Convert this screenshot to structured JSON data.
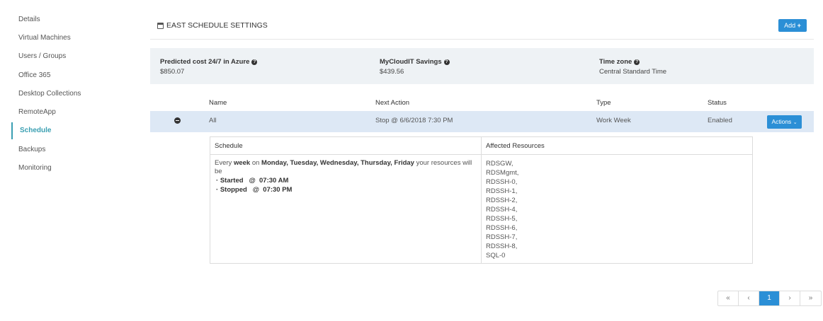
{
  "sidebar": {
    "items": [
      {
        "label": "Details"
      },
      {
        "label": "Virtual Machines"
      },
      {
        "label": "Users / Groups"
      },
      {
        "label": "Office 365"
      },
      {
        "label": "Desktop Collections"
      },
      {
        "label": "RemoteApp"
      },
      {
        "label": "Schedule"
      },
      {
        "label": "Backups"
      },
      {
        "label": "Monitoring"
      }
    ],
    "active": "Schedule"
  },
  "header": {
    "title": "EAST SCHEDULE SETTINGS",
    "add_label": "Add",
    "add_icon": "plus-icon"
  },
  "summary": {
    "predicted": {
      "label": "Predicted cost 24/7 in Azure",
      "value": "$850.07"
    },
    "savings": {
      "label": "MyCloudIT Savings",
      "value": "$439.56"
    },
    "timezone": {
      "label": "Time zone",
      "value": "Central Standard Time"
    }
  },
  "table": {
    "columns": [
      "Name",
      "Next Action",
      "Type",
      "Status"
    ],
    "rows": [
      {
        "name": "All",
        "next_action": "Stop @ 6/6/2018 7:30 PM",
        "type": "Work Week",
        "status": "Enabled",
        "actions_label": "Actions"
      }
    ]
  },
  "detail": {
    "schedule_header": "Schedule",
    "resources_header": "Affected Resources",
    "schedule_every": "Every",
    "schedule_week": "week",
    "schedule_on": "on",
    "schedule_days": "Monday, Tuesday, Wednesday, Thursday, Friday",
    "schedule_suffix": "your resources will be",
    "started": "Started   @  07:30 AM",
    "stopped": "Stopped   @  07:30 PM",
    "resources": [
      "RDSGW,",
      "RDSMgmt,",
      "RDSSH-0,",
      "RDSSH-1,",
      "RDSSH-2,",
      "RDSSH-4,",
      "RDSSH-5,",
      "RDSSH-6,",
      "RDSSH-7,",
      "RDSSH-8,",
      "SQL-0"
    ]
  },
  "pagination": {
    "first": "«",
    "prev": "‹",
    "current": "1",
    "next": "›",
    "last": "»"
  },
  "colors": {
    "accent": "#2b8fd6",
    "active_nav": "#3a9fb2",
    "summary_bg": "#eef2f5",
    "row_bg": "#dde8f5"
  }
}
